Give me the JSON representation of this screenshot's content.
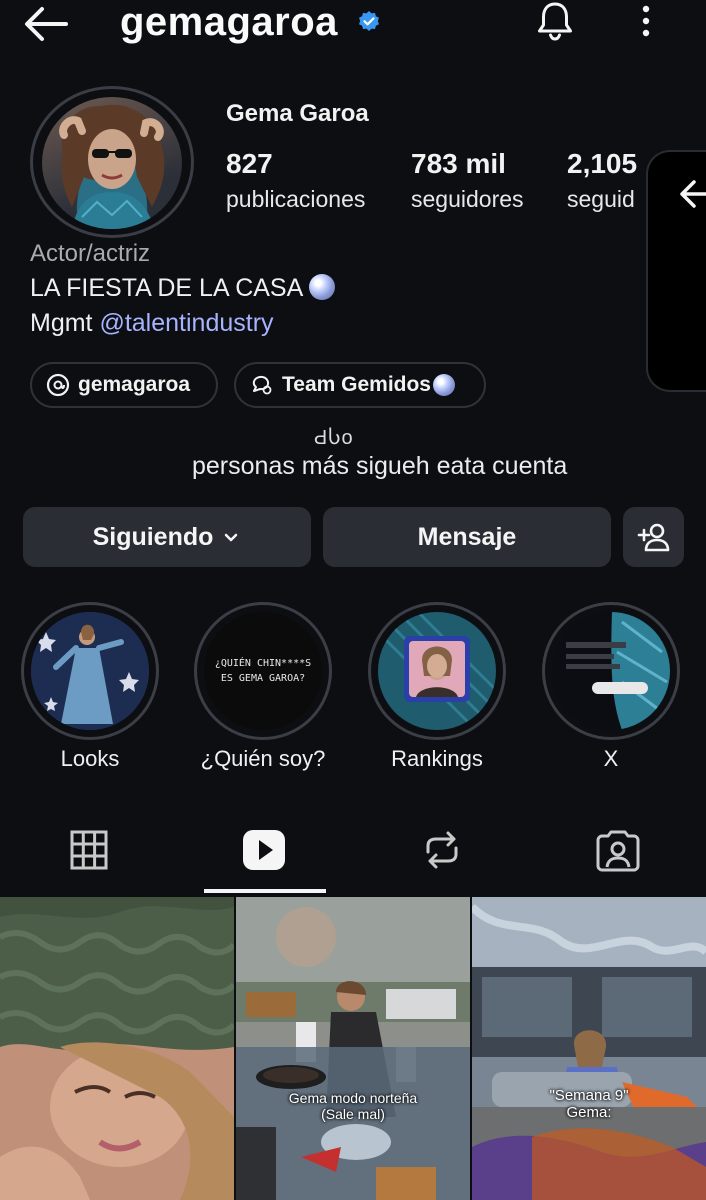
{
  "header": {
    "username": "gemagaroa",
    "back_icon": "arrow-left-icon",
    "verified_icon": "verified-badge-icon",
    "bell_icon": "bell-icon",
    "more_icon": "more-vertical-icon"
  },
  "profile": {
    "full_name": "Gema Garoa",
    "stats": [
      {
        "value": "827",
        "label": "publicaciones"
      },
      {
        "value": "783 mil",
        "label": "seguidores"
      },
      {
        "value": "2,105",
        "label": "seguid"
      }
    ],
    "category": "Actor/actriz",
    "bio_line1": "LA FIESTA DE LA CASA",
    "bio_line2_prefix": "Mgmt ",
    "bio_line2_mention": "@talentindustry",
    "threads_link": "gemagaroa",
    "channel_link": "Team Gemidos"
  },
  "caption": {
    "line1": "ԀႱo",
    "line2": "personas más sigueh eata cuenta"
  },
  "actions": {
    "following_label": "Siguiendo",
    "message_label": "Mensaje",
    "add_user_icon": "add-user-icon"
  },
  "highlights": [
    {
      "label": "Looks"
    },
    {
      "label": "¿Quién soy?",
      "cover_text_1": "¿QUIÉN CHIN****S",
      "cover_text_2": "ES GEMA GAROA?"
    },
    {
      "label": "Rankings"
    },
    {
      "label": "X"
    }
  ],
  "tabs": [
    "grid-icon",
    "reels-icon",
    "reposts-icon",
    "tagged-icon"
  ],
  "grid": [
    {
      "overlay": ""
    },
    {
      "overlay_line1": "Gema modo norteña",
      "overlay_line2": "(Sale mal)"
    },
    {
      "overlay_line1": "\"Semana 9\"",
      "overlay_line2": "Gema:"
    }
  ],
  "colors": {
    "background": "#0d0e12",
    "button": "#2a2d33",
    "mention": "#a7b3ff",
    "verified": "#3897f0"
  }
}
